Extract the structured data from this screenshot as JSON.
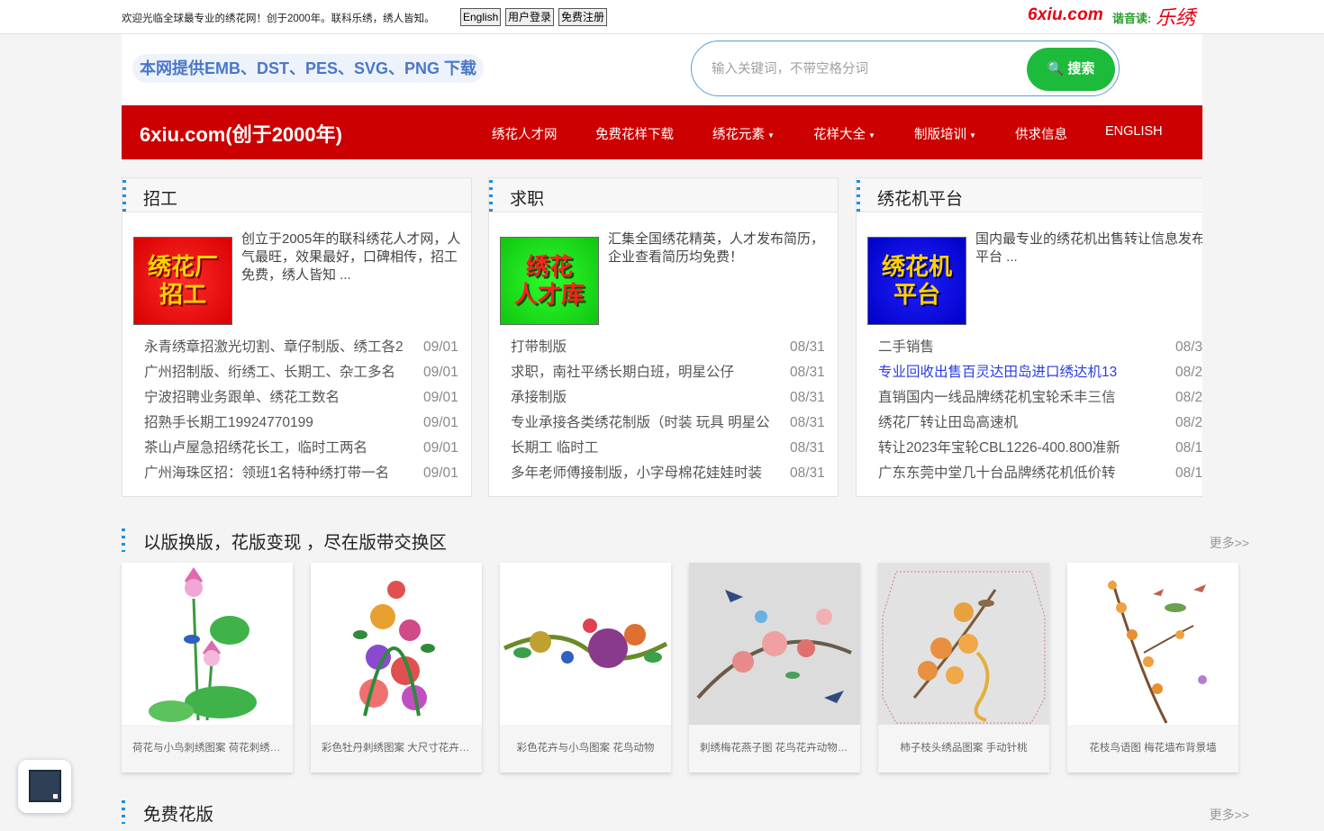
{
  "topbar": {
    "welcome": "欢迎光临全球最专业的绣花网！创于2000年。联科乐绣，绣人皆知。",
    "btn_english": "English",
    "btn_login": "用户登录",
    "btn_register": "免费注册",
    "brand_logo": "6xiu.com",
    "brand_read": "谐音读:",
    "brand_name": "乐绣"
  },
  "header": {
    "slogan": "本网提供EMB、DST、PES、SVG、PNG 下载",
    "search_placeholder": "输入关键词，不带空格分词",
    "search_button": "🔍 搜索"
  },
  "nav": {
    "logo": "6xiu.com(创于2000年)",
    "items": [
      {
        "label": "绣花人才网"
      },
      {
        "label": "免费花样下载"
      },
      {
        "label": "绣花元素"
      },
      {
        "label": "花样大全"
      },
      {
        "label": "制版培训"
      },
      {
        "label": "供求信息"
      },
      {
        "label": "ENGLISH"
      }
    ]
  },
  "panels": [
    {
      "title": "招工",
      "badge": [
        "绣花厂",
        "招工"
      ],
      "desc": "创立于2005年的联科绣花人才网，人气最旺，效果最好，口碑相传，招工免费，绣人皆知 ...",
      "rows": [
        {
          "title": "永青绣章招激光切割、章仔制版、绣工各2",
          "date": "09/01"
        },
        {
          "title": "广州招制版、绗绣工、长期工、杂工多名",
          "date": "09/01"
        },
        {
          "title": "宁波招聘业务跟单、绣花工数名",
          "date": "09/01"
        },
        {
          "title": "招熟手长期工19924770199",
          "date": "09/01"
        },
        {
          "title": "茶山卢屋急招绣花长工，临时工两名",
          "date": "09/01"
        },
        {
          "title": "广州海珠区招：领班1名特种绣打带一名",
          "date": "09/01"
        }
      ]
    },
    {
      "title": "求职",
      "badge": [
        "绣花",
        "人才库"
      ],
      "desc": "汇集全国绣花精英，人才发布简历，企业查看简历均免费！",
      "rows": [
        {
          "title": "打带制版",
          "date": "08/31"
        },
        {
          "title": "求职，南社平绣长期白班，明星公仔",
          "date": "08/31"
        },
        {
          "title": "承接制版",
          "date": "08/31"
        },
        {
          "title": "专业承接各类绣花制版（时装 玩具 明星公",
          "date": "08/31"
        },
        {
          "title": "长期工 临时工",
          "date": "08/31"
        },
        {
          "title": "多年老师傅接制版，小字母棉花娃娃时装",
          "date": "08/31"
        }
      ]
    },
    {
      "title": "绣花机平台",
      "badge": [
        "绣花机",
        "平台"
      ],
      "desc": "国内最专业的绣花机出售转让信息发布平台 ...",
      "rows": [
        {
          "title": "二手销售",
          "date": "08/3"
        },
        {
          "title": "专业回收出售百灵达田岛进口绣达机13",
          "date": "08/2"
        },
        {
          "title": "直销国内一线品牌绣花机宝轮禾丰三信",
          "date": "08/2"
        },
        {
          "title": "绣花厂转让田岛高速机",
          "date": "08/2"
        },
        {
          "title": "转让2023年宝轮CBL1226-400.800准新",
          "date": "08/1"
        },
        {
          "title": "广东东莞中堂几十台品牌绣花机低价转",
          "date": "08/1"
        }
      ]
    }
  ],
  "section_exchange": {
    "title": "以版换版，花版变现 ，尽在版带交换区",
    "more": "更多>>",
    "cards": [
      {
        "caption": "荷花与小鸟刺绣图案 荷花刺绣图案"
      },
      {
        "caption": "彩色牡丹刺绣图案 大尺寸花卉图案"
      },
      {
        "caption": "彩色花卉与小鸟图案 花鸟动物"
      },
      {
        "caption": "刺绣梅花燕子图 花鸟花卉动物图案"
      },
      {
        "caption": "柿子枝头绣品图案 手动针桃"
      },
      {
        "caption": "花枝鸟语图 梅花墙布背景墙"
      }
    ]
  },
  "section_free": {
    "title": "免费花版",
    "more": "更多>>"
  },
  "colors": {
    "nav_red": "#cc0000",
    "search_green": "#1dbb3b",
    "accent_blue": "#1f8fe0",
    "link_blue": "#2a3de0"
  }
}
